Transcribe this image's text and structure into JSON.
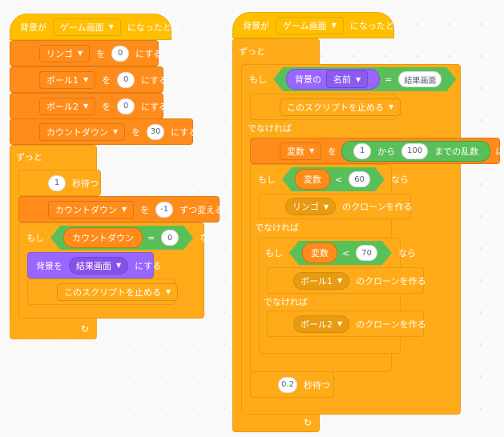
{
  "script1": {
    "hat": {
      "prefix": "背景が",
      "backdrop": "ゲーム画面",
      "suffix": "になったとき"
    },
    "sets": [
      {
        "var": "リンゴ",
        "to": "を",
        "value": "0",
        "action": "にする"
      },
      {
        "var": "ボール1",
        "to": "を",
        "value": "0",
        "action": "にする"
      },
      {
        "var": "ボール2",
        "to": "を",
        "value": "0",
        "action": "にする"
      },
      {
        "var": "カウントダウン",
        "to": "を",
        "value": "30",
        "action": "にする"
      }
    ],
    "forever_label": "ずっと",
    "wait": {
      "value": "1",
      "label": "秒待つ"
    },
    "change": {
      "var": "カウントダウン",
      "to": "を",
      "value": "-1",
      "action": "ずつ変える"
    },
    "if": {
      "label": "もし",
      "left": "カウントダウン",
      "op": "=",
      "right": "0",
      "then": "なら"
    },
    "switch_backdrop": {
      "prefix": "背景を",
      "backdrop": "結果画面",
      "suffix": "にする"
    },
    "stop": {
      "option": "このスクリプトを止める"
    }
  },
  "script2": {
    "hat": {
      "prefix": "背景が",
      "backdrop": "ゲーム画面",
      "suffix": "になったとき"
    },
    "forever_label": "ずっと",
    "if1": {
      "label": "もし",
      "sensing_prefix": "背景の",
      "sensing_attr": "名前",
      "op": "=",
      "right": "結果画面",
      "then": "なら"
    },
    "stop": {
      "option": "このスクリプトを止める"
    },
    "else_label": "でなければ",
    "set_random": {
      "var": "変数",
      "to": "を",
      "from": "1",
      "from_label": "から",
      "to_value": "100",
      "random_label": "までの乱数",
      "action": "にする"
    },
    "if2": {
      "label": "もし",
      "left": "変数",
      "op": "<",
      "right": "60",
      "then": "なら"
    },
    "clone1": {
      "target": "リンゴ",
      "action": "のクローンを作る"
    },
    "else2_label": "でなければ",
    "if3": {
      "label": "もし",
      "left": "変数",
      "op": "<",
      "right": "70",
      "then": "なら"
    },
    "clone2": {
      "target": "ボール1",
      "action": "のクローンを作る"
    },
    "else3_label": "でなければ",
    "clone3": {
      "target": "ボール2",
      "action": "のクローンを作る"
    },
    "wait": {
      "value": "0.2",
      "label": "秒待つ"
    }
  },
  "icons": {
    "dropdown": "▼",
    "loop_arrow": "↻"
  }
}
